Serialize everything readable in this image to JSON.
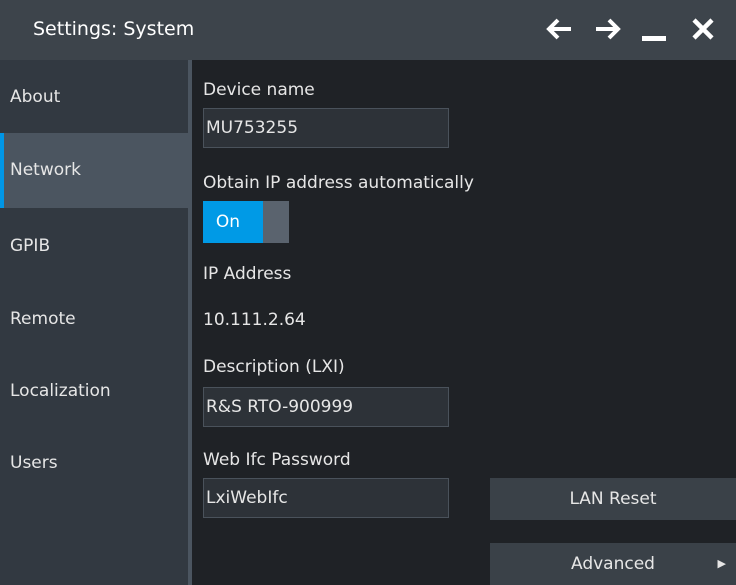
{
  "window": {
    "title": "Settings: System",
    "controls": {
      "back_icon": "arrow-left-icon",
      "forward_icon": "arrow-right-icon",
      "minimize_icon": "minimize-icon",
      "close_icon": "close-icon"
    }
  },
  "sidebar": {
    "items": [
      {
        "label": "About",
        "active": false
      },
      {
        "label": "Network",
        "active": true
      },
      {
        "label": "GPIB",
        "active": false
      },
      {
        "label": "Remote",
        "active": false
      },
      {
        "label": "Localization",
        "active": false
      },
      {
        "label": "Users",
        "active": false
      }
    ]
  },
  "network": {
    "device_name_label": "Device name",
    "device_name_value": "MU753255",
    "obtain_ip_label": "Obtain IP address automatically",
    "obtain_ip_toggle": "On",
    "ip_address_label": "IP Address",
    "ip_address_value": "10.111.2.64",
    "description_label": "Description (LXI)",
    "description_value": "R&S RTO-900999",
    "web_password_label": "Web Ifc Password",
    "web_password_value": "LxiWebIfc",
    "lan_reset_label": "LAN Reset",
    "advanced_label": "Advanced"
  },
  "colors": {
    "accent": "#009ae6",
    "titlebar": "#3d444b",
    "sidebar": "#323941",
    "content_bg": "#1f2226"
  }
}
